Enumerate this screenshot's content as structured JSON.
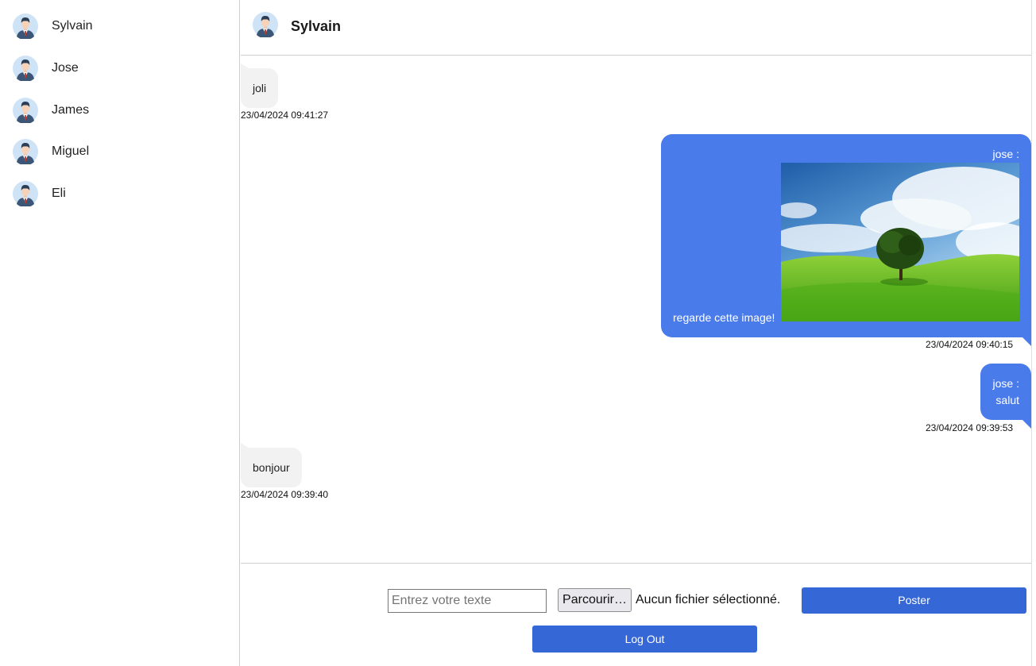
{
  "sidebar": {
    "contacts": [
      {
        "name": "Sylvain"
      },
      {
        "name": "Jose"
      },
      {
        "name": "James"
      },
      {
        "name": "Miguel"
      },
      {
        "name": "Eli"
      }
    ]
  },
  "header": {
    "title": "Sylvain"
  },
  "messages": [
    {
      "direction": "incoming",
      "text": "joli",
      "time": "23/04/2024 09:41:27"
    },
    {
      "direction": "outgoing",
      "sender": "jose :",
      "text": "regarde cette image!",
      "has_image": true,
      "time": "23/04/2024 09:40:15"
    },
    {
      "direction": "outgoing",
      "sender": "jose :",
      "text": "salut",
      "time": "23/04/2024 09:39:53"
    },
    {
      "direction": "incoming",
      "text": "bonjour",
      "time": "23/04/2024 09:39:40"
    }
  ],
  "composer": {
    "placeholder": "Entrez votre texte",
    "browse_label": "Parcourir…",
    "no_file_label": "Aucun fichier sélectionné.",
    "post_label": "Poster",
    "logout_label": "Log Out"
  },
  "colors": {
    "outgoing_bubble": "#4a7bea",
    "incoming_bubble": "#f2f2f2",
    "button": "#3567d6"
  }
}
